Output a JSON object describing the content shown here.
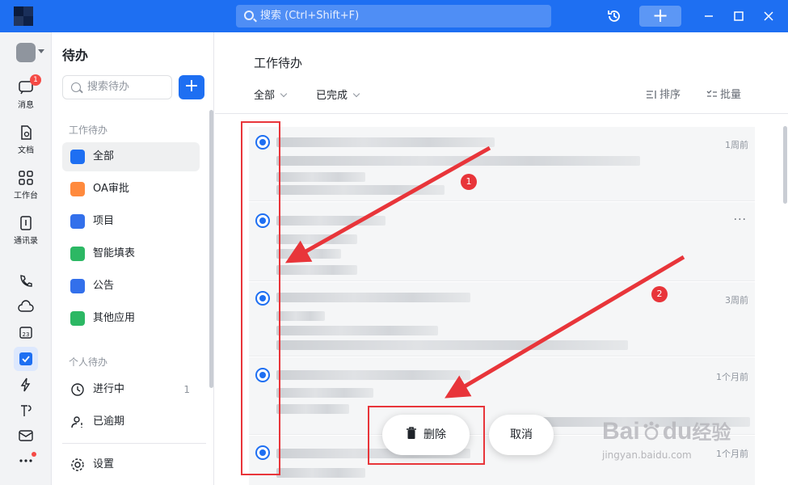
{
  "titlebar": {
    "search_placeholder": "搜索 (Ctrl+Shift+F)",
    "plus_label": "+"
  },
  "rail": {
    "items": [
      {
        "label": "消息",
        "badge": "1"
      },
      {
        "label": "文档"
      },
      {
        "label": "工作台"
      },
      {
        "label": "通讯录"
      }
    ]
  },
  "sidebar": {
    "title": "待办",
    "search_placeholder": "搜索待办",
    "add_label": "+",
    "group_work": "工作待办",
    "work_items": [
      {
        "label": "全部",
        "color": "#1e6ff2"
      },
      {
        "label": "OA审批",
        "color": "#ff8a3d"
      },
      {
        "label": "项目",
        "color": "#3370eb"
      },
      {
        "label": "智能填表",
        "color": "#2cb864"
      },
      {
        "label": "公告",
        "color": "#3370eb"
      },
      {
        "label": "其他应用",
        "color": "#2cb864"
      }
    ],
    "group_personal": "个人待办",
    "personal_items": [
      {
        "label": "进行中",
        "count": "1"
      },
      {
        "label": "已逾期"
      }
    ],
    "settings_label": "设置"
  },
  "main": {
    "title": "工作待办",
    "filter_all": "全部",
    "filter_status": "已完成",
    "sort_label": "排序",
    "batch_label": "批量",
    "cards": [
      {
        "time": "1周前"
      },
      {
        "time": "···"
      },
      {
        "time": "3周前"
      },
      {
        "time": "1个月前"
      },
      {
        "time": "1个月前"
      }
    ],
    "delete_label": "删除",
    "cancel_label": "取消"
  },
  "annotations": {
    "badge1": "1",
    "badge2": "2",
    "accent": "#e8353a"
  },
  "watermark": {
    "brand": "Bai",
    "brand2": "du",
    "cn": "经验",
    "url": "jingyan.baidu.com"
  },
  "colors": {
    "brand": "#1e6ff2",
    "badge": "#f54a45"
  }
}
